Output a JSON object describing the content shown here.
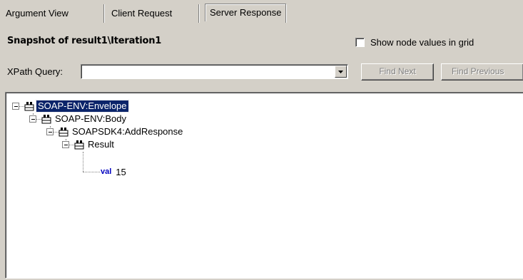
{
  "tabs": [
    {
      "label": "Argument View",
      "active": false
    },
    {
      "label": "Client Request",
      "active": false
    },
    {
      "label": "Server Response",
      "active": true
    }
  ],
  "snapshot": {
    "title": "Snapshot of result1\\Iteration1"
  },
  "options": {
    "show_node_values_label": "Show node values in grid",
    "show_node_values_checked": false
  },
  "xpath": {
    "label": "XPath Query:",
    "value": ""
  },
  "buttons": {
    "find_next": "Find Next",
    "find_previous": "Find Previous"
  },
  "tree": {
    "nodes": [
      {
        "label": "SOAP-ENV:Envelope",
        "selected": true
      },
      {
        "label": "SOAP-ENV:Body"
      },
      {
        "label": "SOAPSDK4:AddResponse"
      },
      {
        "label": "Result"
      }
    ],
    "attribute": {
      "name": "val",
      "value": "15"
    }
  },
  "colors": {
    "selection": "#0a246a",
    "attr_name": "#0000c0",
    "dialog_bg": "#d4d0c8"
  }
}
